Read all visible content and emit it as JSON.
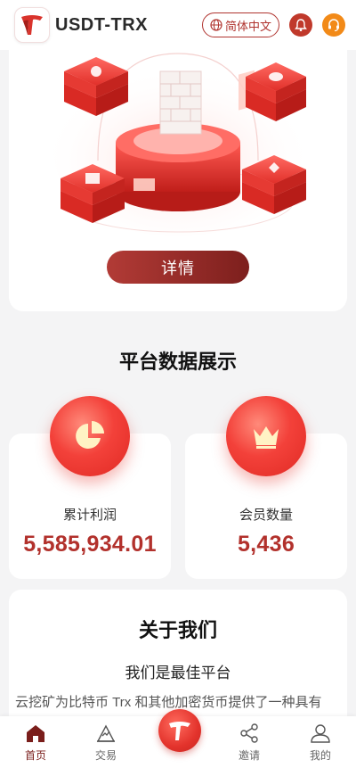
{
  "header": {
    "app_title": "USDT-TRX",
    "language_label": "简体中文",
    "icons": [
      "logo-icon",
      "globe-icon",
      "bell-icon",
      "headset-icon"
    ]
  },
  "hero": {
    "details_label": "详情"
  },
  "stats": {
    "section_title": "平台数据展示",
    "items": [
      {
        "label": "累计利润",
        "value": "5,585,934.01",
        "icon": "pie-chart-icon"
      },
      {
        "label": "会员数量",
        "value": "5,436",
        "icon": "crown-icon"
      }
    ]
  },
  "about": {
    "title": "关于我们",
    "subtitle": "我们是最佳平台",
    "text": "云挖矿为比特币 Trx 和其他加密货币提供了一种具有"
  },
  "nav": {
    "items": [
      {
        "label": "首页",
        "icon": "home-icon",
        "active": true
      },
      {
        "label": "交易",
        "icon": "trade-icon",
        "active": false
      },
      {
        "label": "",
        "icon": "center-logo-icon",
        "active": false
      },
      {
        "label": "邀请",
        "icon": "share-icon",
        "active": false
      },
      {
        "label": "我的",
        "icon": "user-icon",
        "active": false
      }
    ]
  },
  "colors": {
    "accent": "#b2312c",
    "accent_dark": "#7d1f1d",
    "service": "#f28a18"
  }
}
